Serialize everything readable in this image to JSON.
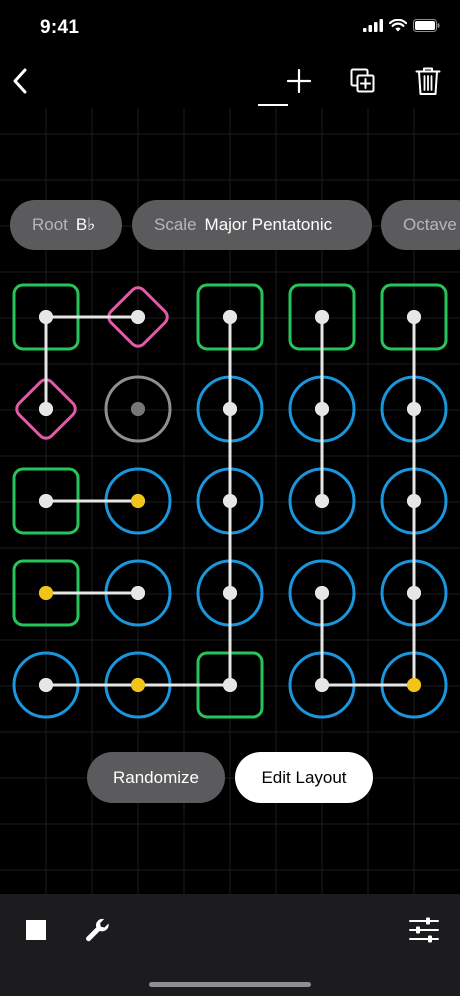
{
  "status": {
    "time": "9:41",
    "icons": [
      "cellular-signal-icon",
      "wifi-icon",
      "battery-icon"
    ]
  },
  "toolbar": {
    "back": "chevron-left-icon",
    "add": "plus-icon",
    "duplicate": "duplicate-icon",
    "delete": "trash-icon"
  },
  "settings": {
    "root": {
      "label": "Root",
      "value": "B♭"
    },
    "scale": {
      "label": "Scale",
      "value": "Major Pentatonic"
    },
    "octave": {
      "label": "Octave",
      "value": ""
    }
  },
  "pad_grid": {
    "columns": 5,
    "rows": 5,
    "legend_colors": {
      "tonic": "#27c45a",
      "root_alt": "#e05aa8",
      "note": "#1a96dc",
      "inactive": "#8e8e93",
      "cursor": "#f0c419",
      "link": "#e6e6e6"
    },
    "pads": [
      {
        "row": 0,
        "col": 0,
        "shape": "square",
        "color": "#27c45a",
        "dot": "white"
      },
      {
        "row": 0,
        "col": 1,
        "shape": "diamond",
        "color": "#e05aa8",
        "dot": "white"
      },
      {
        "row": 0,
        "col": 2,
        "shape": "square",
        "color": "#27c45a",
        "dot": "white"
      },
      {
        "row": 0,
        "col": 3,
        "shape": "square",
        "color": "#27c45a",
        "dot": "white"
      },
      {
        "row": 0,
        "col": 4,
        "shape": "square",
        "color": "#27c45a",
        "dot": "white"
      },
      {
        "row": 1,
        "col": 0,
        "shape": "diamond",
        "color": "#e05aa8",
        "dot": "white"
      },
      {
        "row": 1,
        "col": 1,
        "shape": "circle",
        "color": "#8e8e93",
        "dot": "gray"
      },
      {
        "row": 1,
        "col": 2,
        "shape": "circle",
        "color": "#1a96dc",
        "dot": "white"
      },
      {
        "row": 1,
        "col": 3,
        "shape": "circle",
        "color": "#1a96dc",
        "dot": "white"
      },
      {
        "row": 1,
        "col": 4,
        "shape": "circle",
        "color": "#1a96dc",
        "dot": "white"
      },
      {
        "row": 2,
        "col": 0,
        "shape": "square",
        "color": "#27c45a",
        "dot": "white"
      },
      {
        "row": 2,
        "col": 1,
        "shape": "circle",
        "color": "#1a96dc",
        "dot": "yellow"
      },
      {
        "row": 2,
        "col": 2,
        "shape": "circle",
        "color": "#1a96dc",
        "dot": "white"
      },
      {
        "row": 2,
        "col": 3,
        "shape": "circle",
        "color": "#1a96dc",
        "dot": "white"
      },
      {
        "row": 2,
        "col": 4,
        "shape": "circle",
        "color": "#1a96dc",
        "dot": "white"
      },
      {
        "row": 3,
        "col": 0,
        "shape": "square",
        "color": "#27c45a",
        "dot": "yellow"
      },
      {
        "row": 3,
        "col": 1,
        "shape": "circle",
        "color": "#1a96dc",
        "dot": "white"
      },
      {
        "row": 3,
        "col": 2,
        "shape": "circle",
        "color": "#1a96dc",
        "dot": "white"
      },
      {
        "row": 3,
        "col": 3,
        "shape": "circle",
        "color": "#1a96dc",
        "dot": "white"
      },
      {
        "row": 3,
        "col": 4,
        "shape": "circle",
        "color": "#1a96dc",
        "dot": "white"
      },
      {
        "row": 4,
        "col": 0,
        "shape": "circle",
        "color": "#1a96dc",
        "dot": "white"
      },
      {
        "row": 4,
        "col": 1,
        "shape": "circle",
        "color": "#1a96dc",
        "dot": "yellow"
      },
      {
        "row": 4,
        "col": 2,
        "shape": "square",
        "color": "#27c45a",
        "dot": "white"
      },
      {
        "row": 4,
        "col": 3,
        "shape": "circle",
        "color": "#1a96dc",
        "dot": "white"
      },
      {
        "row": 4,
        "col": 4,
        "shape": "circle",
        "color": "#1a96dc",
        "dot": "yellow"
      }
    ],
    "links": [
      [
        [
          0,
          0
        ],
        [
          0,
          1
        ]
      ],
      [
        [
          0,
          0
        ],
        [
          1,
          0
        ]
      ],
      [
        [
          0,
          2
        ],
        [
          4,
          2
        ]
      ],
      [
        [
          0,
          3
        ],
        [
          2,
          3
        ]
      ],
      [
        [
          0,
          4
        ],
        [
          4,
          4
        ]
      ],
      [
        [
          2,
          0
        ],
        [
          2,
          1
        ]
      ],
      [
        [
          3,
          0
        ],
        [
          3,
          1
        ]
      ],
      [
        [
          4,
          0
        ],
        [
          4,
          2
        ]
      ],
      [
        [
          3,
          3
        ],
        [
          4,
          3
        ]
      ],
      [
        [
          4,
          3
        ],
        [
          4,
          4
        ]
      ]
    ]
  },
  "actions": {
    "randomize": "Randomize",
    "edit_layout": "Edit Layout"
  },
  "bottom_bar": {
    "stop": "stop-icon",
    "tools": "wrench-icon",
    "mixer": "sliders-icon"
  }
}
